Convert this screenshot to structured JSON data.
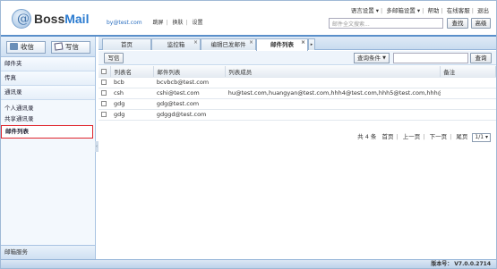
{
  "header": {
    "logo_text_part1": "Boss",
    "logo_text_part2": "Mail",
    "user_email": "by@test.com",
    "links": [
      "跳屏",
      "换肤",
      "设置"
    ],
    "top_menu": [
      "语言设置 ▾",
      "多邮箱设置 ▾",
      "帮助",
      "在线客服",
      "退出"
    ],
    "search_placeholder": "邮件全文搜索...",
    "search_button": "查找",
    "advanced_button": "高级"
  },
  "sidebar": {
    "inbox_label": "收信",
    "compose_label": "写信",
    "sections": [
      "邮件夹",
      "传真",
      "通讯录"
    ],
    "sub_items": [
      "个人通讯录",
      "共享通讯录",
      "邮件列表"
    ],
    "bottom_label": "邮箱服务"
  },
  "tabs": [
    {
      "label": "首页"
    },
    {
      "label": "监控箱"
    },
    {
      "label": "编辑已发邮件"
    },
    {
      "label": "邮件列表"
    }
  ],
  "toolbar": {
    "write_button": "写信",
    "query_condition": "查询条件",
    "query_button": "查询"
  },
  "table": {
    "headers": [
      "列表名",
      "邮件列表",
      "列表成员",
      "备注"
    ],
    "rows": [
      {
        "name": "bcb",
        "mail": "bcvbcb@test.com",
        "members": "",
        "note": ""
      },
      {
        "name": "csh",
        "mail": "cshi@test.com",
        "members": "hu@test.com,huangyan@test.com,hhh4@test.com,hhh5@test.com,hhh@...",
        "note": ""
      },
      {
        "name": "gdg",
        "mail": "gdg@test.com",
        "members": "",
        "note": ""
      },
      {
        "name": "gdg",
        "mail": "gdggd@test.com",
        "members": "",
        "note": ""
      }
    ]
  },
  "pager": {
    "total": "共 4 条",
    "first": "首页",
    "prev": "上一页",
    "next": "下一页",
    "last": "尾页",
    "page_select": "1/1 ▾"
  },
  "footer": {
    "version": "版本号： V7.0.0.2714"
  },
  "colors": {
    "accent": "#5a8fca",
    "highlight_border": "#e0252c"
  }
}
